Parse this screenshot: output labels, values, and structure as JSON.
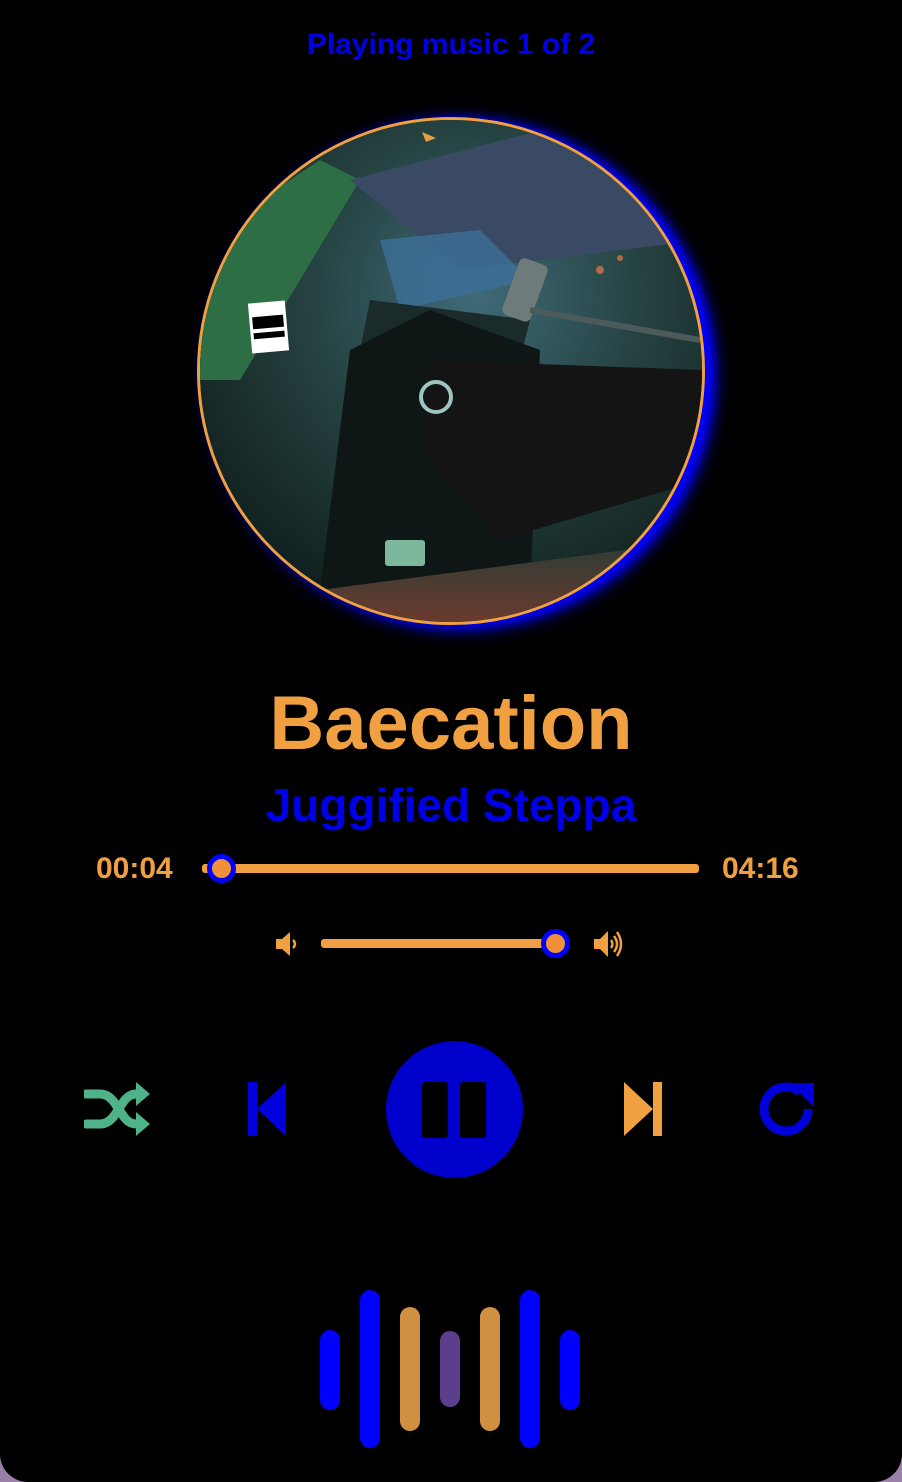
{
  "header": {
    "now_playing_label": "Playing music 1 of 2"
  },
  "track": {
    "title": "Baecation",
    "artist": "Juggified Steppa",
    "current_time": "00:04",
    "total_time": "04:16",
    "progress_fraction": 0.016
  },
  "volume": {
    "level_fraction": 1.0
  },
  "controls": {
    "shuffle_icon": "shuffle-icon",
    "prev_icon": "skip-previous-icon",
    "play_pause_icon": "pause-icon",
    "next_icon": "skip-next-icon",
    "repeat_icon": "repeat-icon"
  },
  "colors": {
    "accent_orange": "#f0a040",
    "accent_blue": "#0000e6",
    "shuffle_green": "#4fb389",
    "background": "#000000"
  },
  "album_art": {
    "badge_text": "PARENTAL ADVISORY EXPLICIT CONTENT"
  }
}
